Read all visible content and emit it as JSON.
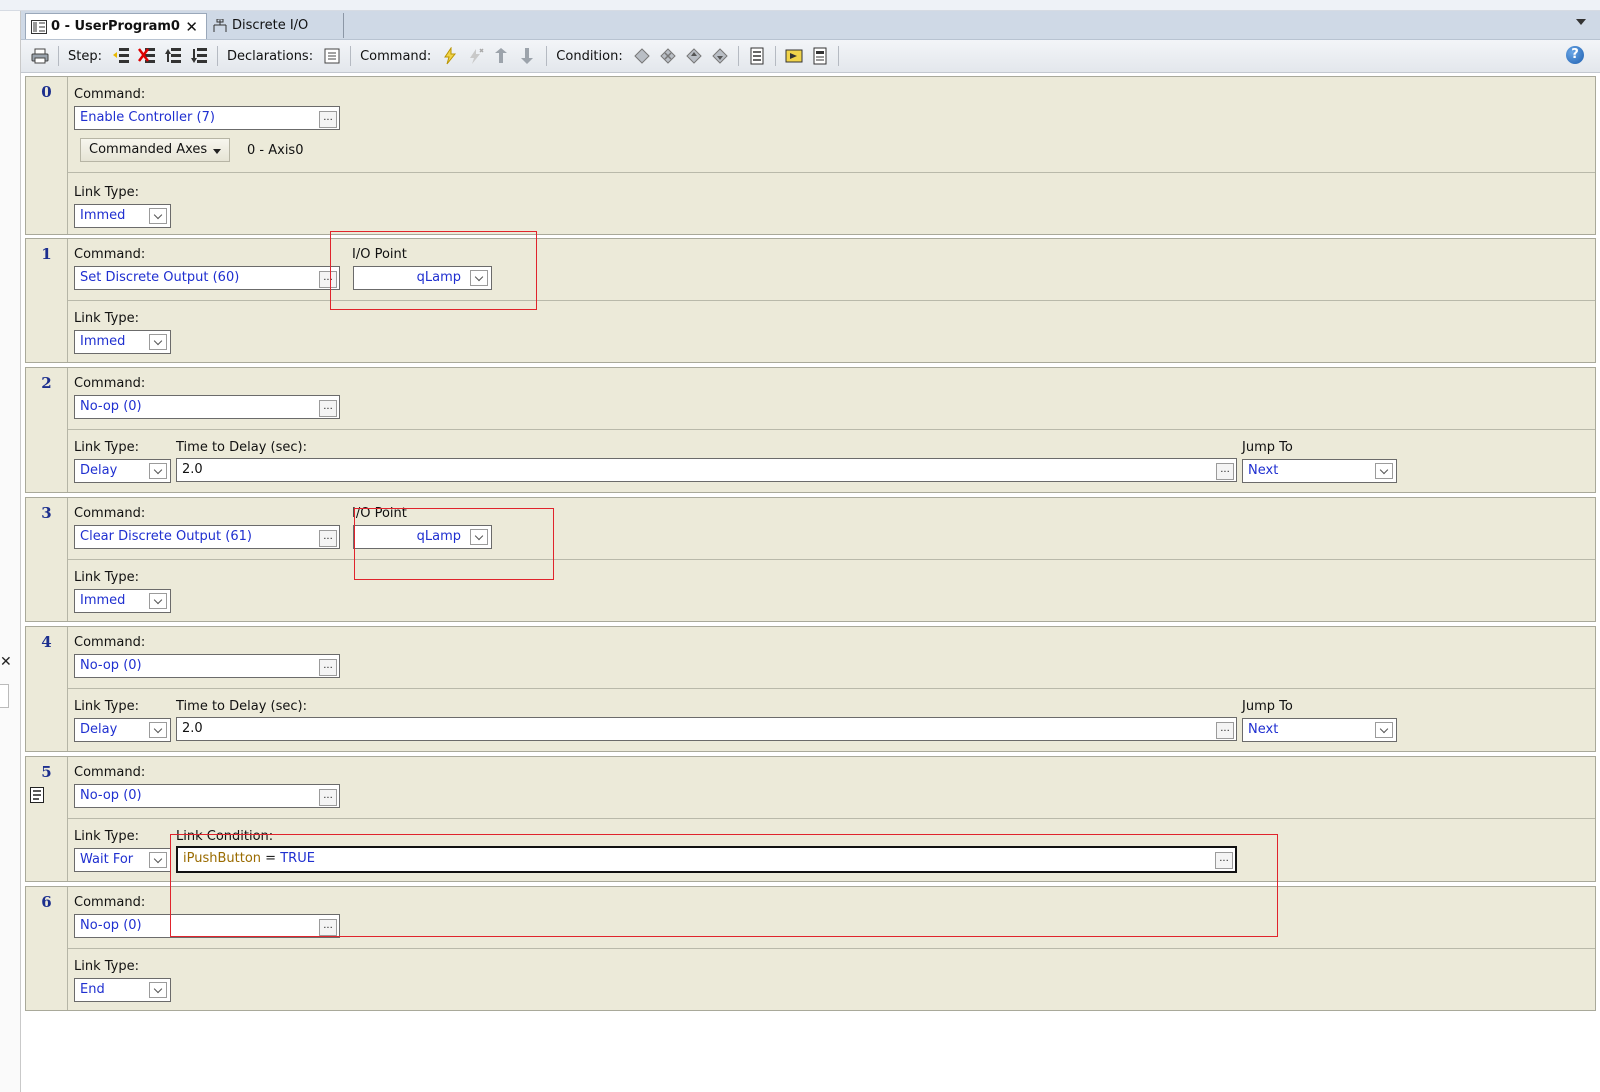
{
  "tabs": [
    {
      "label": "0 - UserProgram0",
      "active": true
    },
    {
      "label": "Discrete I/O",
      "active": false
    }
  ],
  "toolbar": {
    "step_label": "Step:",
    "declarations_label": "Declarations:",
    "command_label": "Command:",
    "condition_label": "Condition:",
    "help": "?"
  },
  "labels": {
    "command": "Command:",
    "link_type": "Link Type:",
    "io_point": "I/O Point",
    "time_to_delay": "Time to Delay (sec):",
    "jump_to": "Jump To",
    "link_condition": "Link Condition:",
    "ellipsis": "..."
  },
  "steps": [
    {
      "num": "0",
      "command": "Enable Controller (7)",
      "commanded_axes_label": "Commanded Axes",
      "commanded_axes_value": "0 - Axis0",
      "link_type": "Immed"
    },
    {
      "num": "1",
      "command": "Set Discrete Output (60)",
      "io_point": "qLamp",
      "link_type": "Immed"
    },
    {
      "num": "2",
      "command": "No-op (0)",
      "link_type": "Delay",
      "delay": "2.0",
      "jump_to": "Next"
    },
    {
      "num": "3",
      "command": "Clear Discrete Output (61)",
      "io_point": "qLamp",
      "link_type": "Immed"
    },
    {
      "num": "4",
      "command": "No-op (0)",
      "link_type": "Delay",
      "delay": "2.0",
      "jump_to": "Next"
    },
    {
      "num": "5",
      "command": "No-op (0)",
      "link_type": "Wait For",
      "condition": {
        "variable": "iPushButton",
        "operator": "=",
        "value": "TRUE"
      }
    },
    {
      "num": "6",
      "command": "No-op (0)",
      "link_type": "End"
    }
  ],
  "colors": {
    "highlight": "#e0242c",
    "field_text": "#1f2fd0",
    "step_bg": "#ecead9",
    "step_number": "#1c2f8e"
  }
}
